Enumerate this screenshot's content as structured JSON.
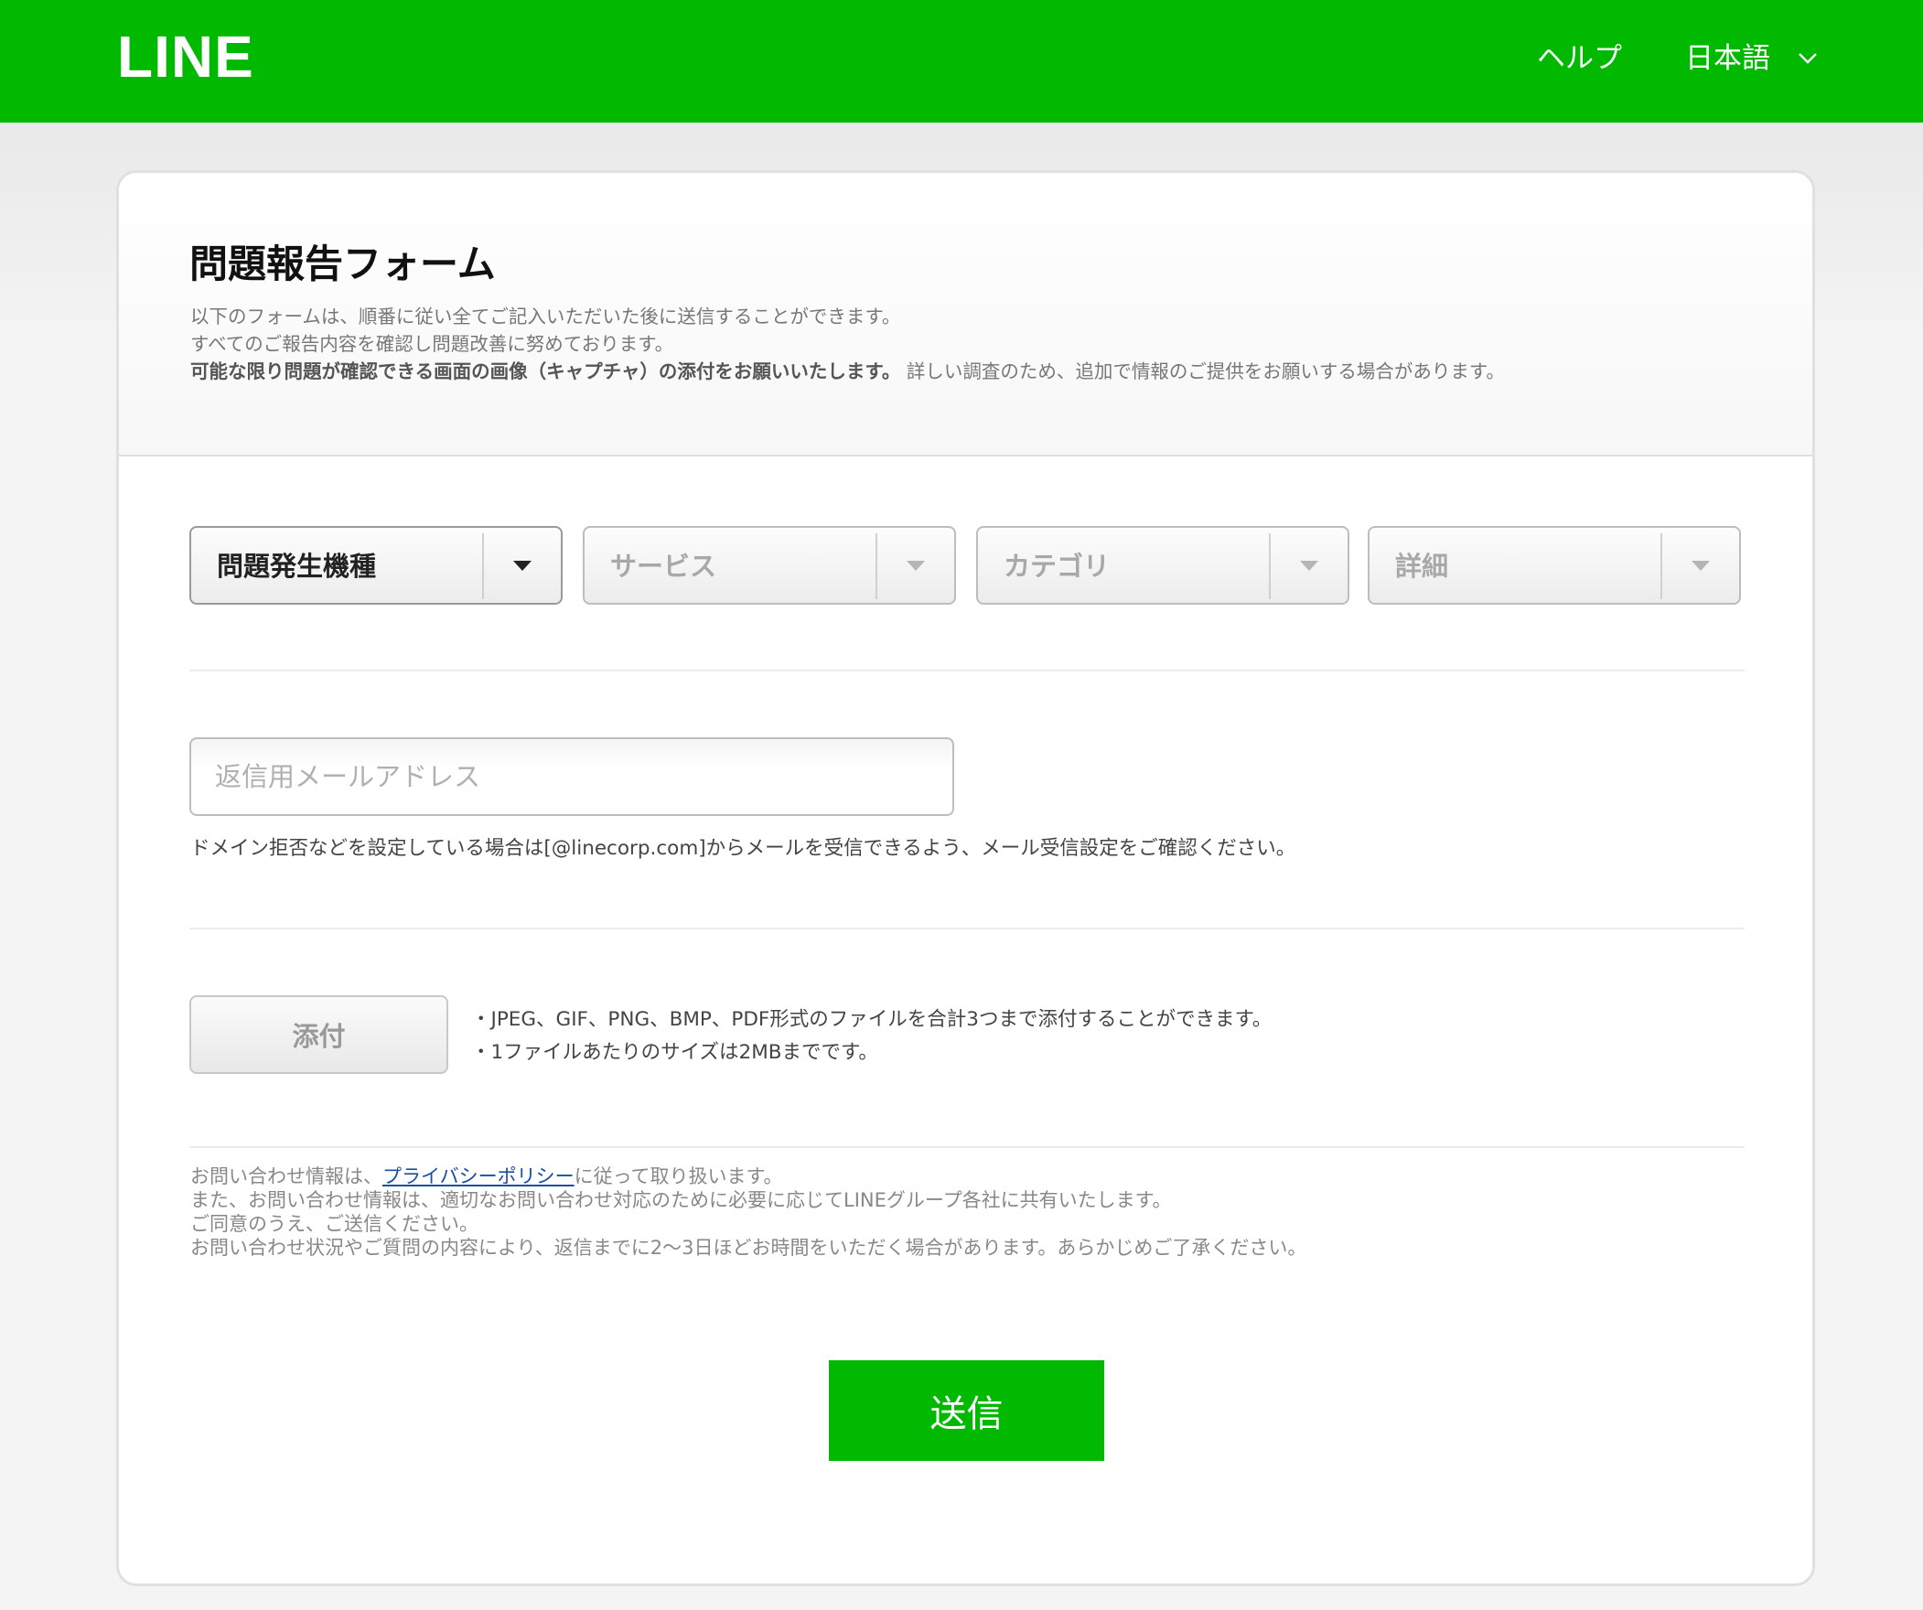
{
  "header": {
    "logo": "LINE",
    "help": "ヘルプ",
    "language": "日本語"
  },
  "form": {
    "title": "問題報告フォーム",
    "intro_line1": "以下のフォームは、順番に従い全てご記入いただいた後に送信することができます。",
    "intro_line2": "すべてのご報告内容を確認し問題改善に努めております。",
    "intro_bold": "可能な限り問題が確認できる画面の画像（キャプチャ）の添付をお願いいたします。",
    "intro_rest": "詳しい調査のため、追加で情報のご提供をお願いする場合があります。",
    "selects": [
      {
        "label": "問題発生機種",
        "active": true
      },
      {
        "label": "サービス",
        "active": false
      },
      {
        "label": "カテゴリ",
        "active": false
      },
      {
        "label": "詳細",
        "active": false
      }
    ],
    "email_placeholder": "返信用メールアドレス",
    "email_note": "ドメイン拒否などを設定している場合は[@linecorp.com]からメールを受信できるよう、メール受信設定をご確認ください。",
    "attach_label": "添付",
    "attach_note1": "・JPEG、GIF、PNG、BMP、PDF形式のファイルを合計3つまで添付することができます。",
    "attach_note2": "・1ファイルあたりのサイズは2MBまでです。",
    "privacy_prefix": "お問い合わせ情報は、",
    "privacy_link": "プライバシーポリシー",
    "privacy_suffix": "に従って取り扱います。",
    "privacy_line2": "また、お問い合わせ情報は、適切なお問い合わせ対応のために必要に応じてLINEグループ各社に共有いたします。",
    "privacy_line3": "ご同意のうえ、ご送信ください。",
    "privacy_line4": "お問い合わせ状況やご質問の内容により、返信までに2〜3日ほどお時間をいただく場合があります。あらかじめご了承ください。",
    "submit_label": "送信"
  },
  "colors": {
    "brand_green": "#00b900",
    "link_blue": "#1a4fa6"
  }
}
